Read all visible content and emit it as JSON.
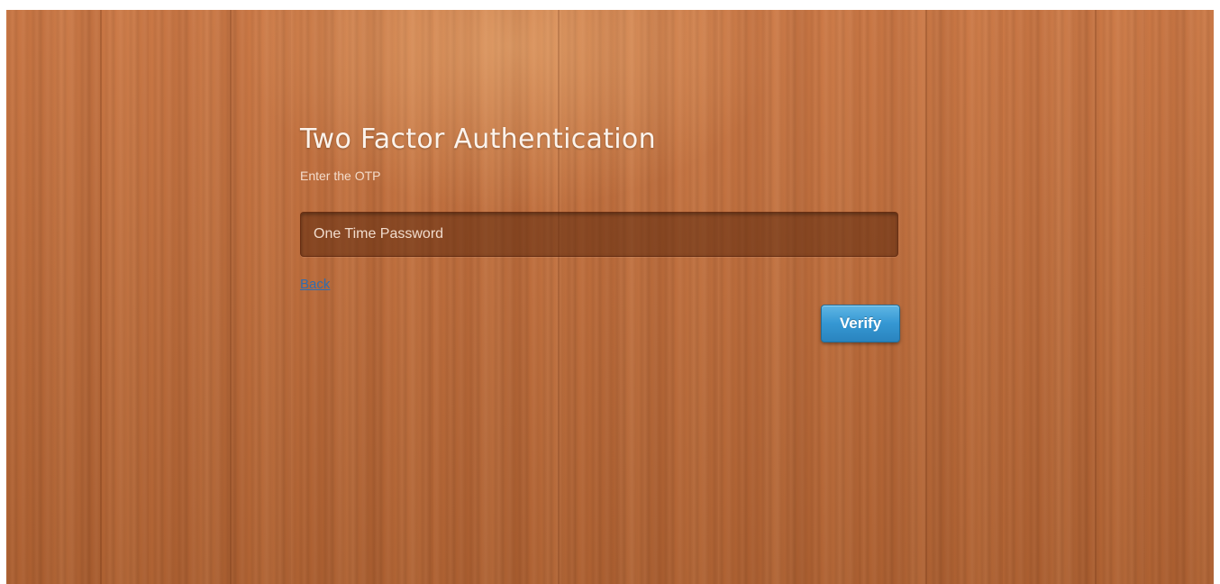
{
  "auth": {
    "title": "Two Factor Authentication",
    "subtitle": "Enter the OTP",
    "otp_placeholder": "One Time Password",
    "otp_value": "",
    "back_link": "Back",
    "verify_button": "Verify"
  },
  "colors": {
    "background_wood": "#c8703a",
    "button_blue": "#3597d3",
    "link_blue": "#2f6db0",
    "title_text": "#fbf3ec"
  }
}
